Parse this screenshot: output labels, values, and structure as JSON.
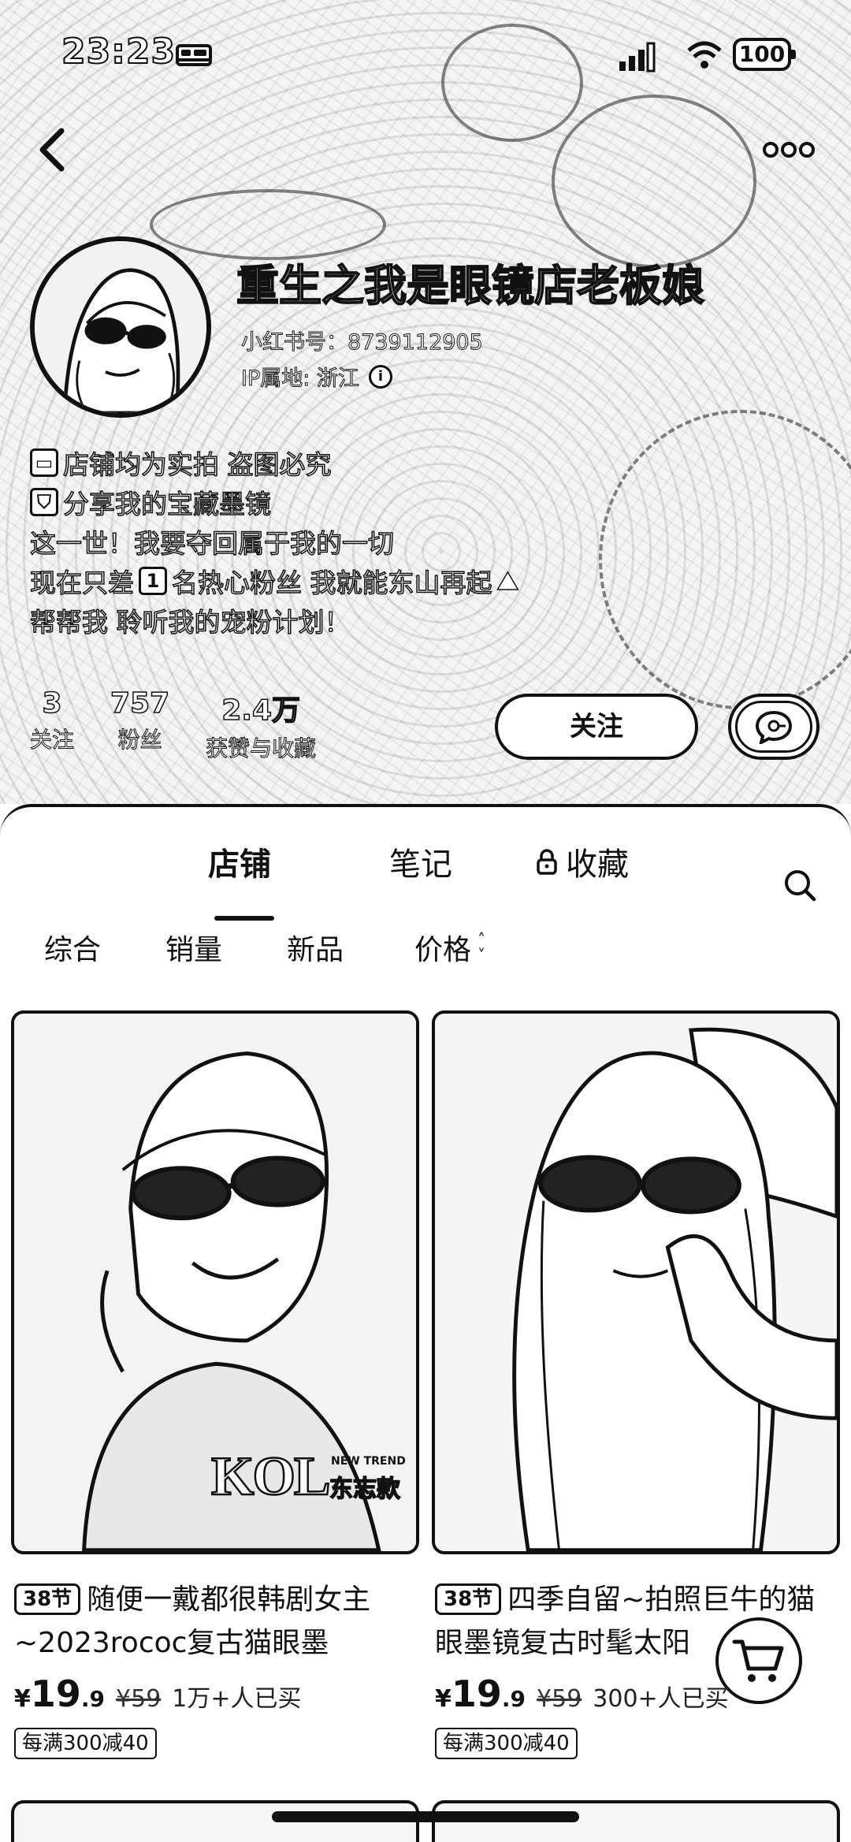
{
  "status_bar": {
    "time": "23:23",
    "battery": "100"
  },
  "profile": {
    "name": "重生之我是眼镜店老板娘",
    "id_text": "小红书号：8739112905",
    "ip_text": "IP属地: 浙江",
    "bio": [
      {
        "icon": "▭",
        "text": "店铺均为实拍  盗图必究"
      },
      {
        "icon": "⛉",
        "text": "分享我的宝藏墨镜"
      },
      {
        "icon": "",
        "text": "这一世！我要夺回属于我的一切"
      },
      {
        "icon": "",
        "text": "现在只差",
        "badge": "1",
        "text2": "名热心粉丝 我就能东山再起",
        "trail": "⛰"
      },
      {
        "icon": "",
        "text": "帮帮我 聆听我的宠粉计划！"
      }
    ]
  },
  "stats": [
    {
      "num": "3",
      "label": "关注"
    },
    {
      "num": "757",
      "label": "粉丝"
    },
    {
      "num": "2.4万",
      "label": "获赞与收藏"
    }
  ],
  "actions": {
    "follow": "关注"
  },
  "tabs": [
    {
      "label": "店铺",
      "active": true
    },
    {
      "label": "笔记",
      "active": false
    },
    {
      "label": "收藏",
      "active": false,
      "locked": true
    }
  ],
  "sort": [
    {
      "label": "综合"
    },
    {
      "label": "销量"
    },
    {
      "label": "新品"
    },
    {
      "label": "价格"
    }
  ],
  "products": [
    {
      "badge": "38节",
      "title": "随便一戴都很韩剧女主~2023rococ复古猫眼墨",
      "price_int": "19",
      "price_dec": ".9",
      "orig_price": "¥59",
      "sold": "1万+人已买",
      "promo": "每满300减40",
      "overlay_main": "KOL",
      "overlay_top": "NEW TREND",
      "overlay_sub": "东志款"
    },
    {
      "badge": "38节",
      "title": "四季自留~拍照巨牛的猫眼墨镜复古时髦太阳",
      "price_int": "19",
      "price_dec": ".9",
      "orig_price": "¥59",
      "sold": "300+人已买",
      "promo": "每满300减40"
    }
  ],
  "currency": "¥"
}
